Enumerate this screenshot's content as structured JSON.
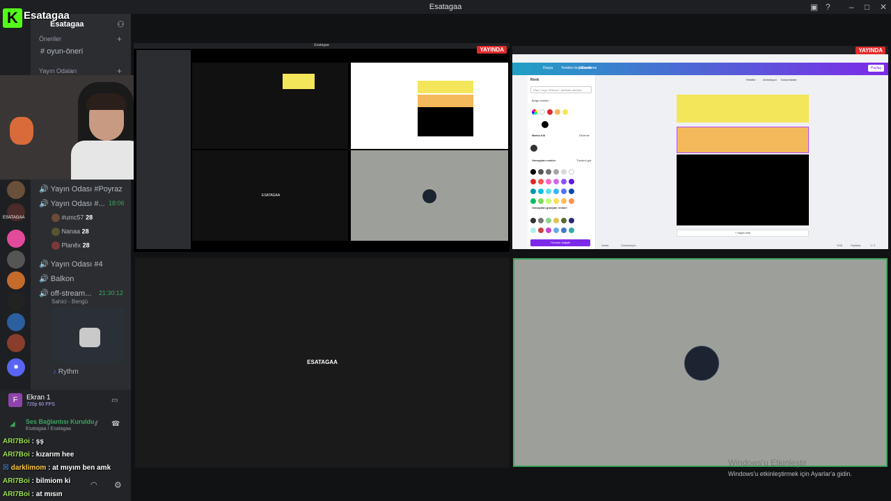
{
  "window": {
    "title": "Esatagaa"
  },
  "overlay": {
    "brand": "Esatagaa",
    "logo_letter": "K"
  },
  "sidebar": {
    "server_name": "Esatagaa",
    "category_suggestions": "Öneriler",
    "channel_oyun": "oyun-öneri",
    "category_broadcast": "Yayın Odaları",
    "voice_channels": [
      {
        "name": "Yayın Odası #Poyraz"
      },
      {
        "name": "Yayın Odası #...",
        "timer": "18:06"
      },
      {
        "name": "Yayın Odası #4"
      },
      {
        "name": "Balkon"
      },
      {
        "name": "off-stream...",
        "timer": "21:30:12",
        "status": "Sahici - Bengü"
      }
    ],
    "voice_users": [
      {
        "name": "#umc57",
        "badge": "28"
      },
      {
        "name": "Nanaa",
        "badge": "28"
      },
      {
        "name": "Planêx",
        "badge": "28"
      }
    ],
    "bot_name": "Rythm",
    "server_label": "ESATAGAA"
  },
  "stream_panel": {
    "title": "Ekran 1",
    "quality": "720p 60 FPS",
    "connection": "Ses Bağlantısı Kuruldu",
    "connection_sub": "Esatagaa / Esatagaa"
  },
  "chat": [
    {
      "user": "ARI7Boi",
      "msg": "şş"
    },
    {
      "user": "ARI7Boi",
      "msg": "kızarım hee"
    },
    {
      "user": "darklimom",
      "msg": "at mıyım ben amk"
    },
    {
      "user": "ARI7Boi",
      "msg": "bilmiom ki"
    },
    {
      "user": "ARI7Boi",
      "msg": "at mısın"
    }
  ],
  "tiles": {
    "live_label": "YAYINDA",
    "center_user": "ESATAGAA",
    "top_left_title": "Esatagaa"
  },
  "canva": {
    "menu": [
      "Dosya",
      "Yeniden boyutlandır",
      "Düzenleme"
    ],
    "toolbar_right": [
      "Efektler",
      "Animasyon",
      "Konumlandır"
    ],
    "share": "Paylaş",
    "panel_title": "Renk",
    "search_placeholder": "\"Mavi\" veya \"#00c4cc\" şeklinde deneyin",
    "doc_colors": "Belge renkleri",
    "brand_kit": "Marka Kiti",
    "edit": "Düzenle",
    "default_colors": "Varsayılan renkler",
    "see_all": "Tümünü gör",
    "default_gradients": "Varsayılan gradyan renkler",
    "change_all": "Tümünü değiştir",
    "add_page": "+ Sayfa ekle",
    "notes": "Notlar",
    "timer": "Zamanlayıcı",
    "pages": "Sayfalar",
    "page_count": "1 / 1",
    "zoom": "%36"
  },
  "activation": {
    "title": "Windows'u Etkinleştir",
    "subtitle": "Windows'u etkinleştirmek için Ayarlar'a gidin."
  }
}
